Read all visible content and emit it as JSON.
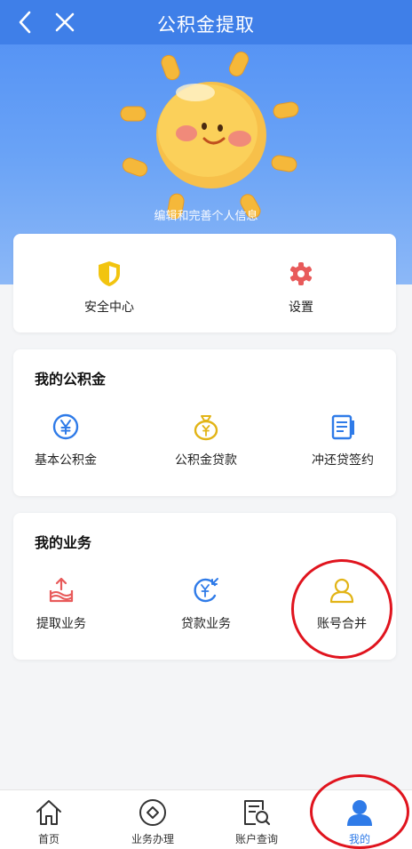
{
  "header": {
    "title": "公积金提取"
  },
  "profile": {
    "caption": "编辑和完善个人信息"
  },
  "quick": {
    "items": [
      {
        "label": "安全中心",
        "icon": "shield-icon"
      },
      {
        "label": "设置",
        "icon": "gear-icon"
      }
    ]
  },
  "fund": {
    "title": "我的公积金",
    "items": [
      {
        "label": "基本公积金",
        "icon": "yuan-circle-icon"
      },
      {
        "label": "公积金贷款",
        "icon": "money-bag-icon"
      },
      {
        "label": "冲还贷签约",
        "icon": "document-icon"
      }
    ]
  },
  "business": {
    "title": "我的业务",
    "items": [
      {
        "label": "提取业务",
        "icon": "withdraw-icon"
      },
      {
        "label": "贷款业务",
        "icon": "loan-icon"
      },
      {
        "label": "账号合并",
        "icon": "user-outline-icon"
      }
    ]
  },
  "tabbar": {
    "items": [
      {
        "label": "首页",
        "icon": "home-icon"
      },
      {
        "label": "业务办理",
        "icon": "diamond-circle-icon"
      },
      {
        "label": "账户查询",
        "icon": "search-document-icon"
      },
      {
        "label": "我的",
        "icon": "user-icon",
        "active": true
      }
    ]
  },
  "colors": {
    "primary": "#3f7fe8",
    "accent_yellow": "#f2c40f",
    "accent_red": "#e85a5a",
    "annotation": "#e0141e"
  }
}
